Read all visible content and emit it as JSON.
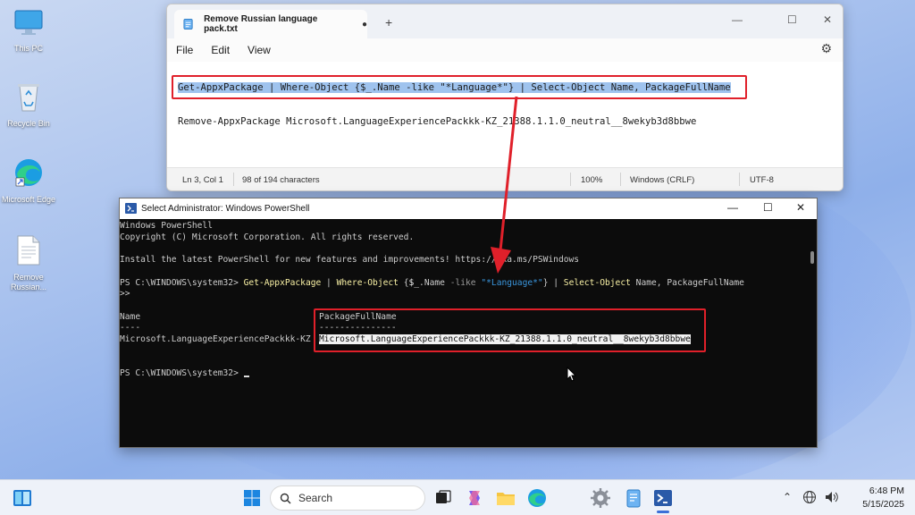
{
  "desktop": {
    "icons": [
      {
        "label": "This PC"
      },
      {
        "label": "Recycle Bin"
      },
      {
        "label": "Microsoft Edge"
      },
      {
        "label": "Remove Russian..."
      }
    ]
  },
  "notepad": {
    "tab_title": "Remove Russian language pack.txt",
    "tab_modified": "●",
    "new_tab": "+",
    "minimize": "—",
    "maximize": "☐",
    "close": "✕",
    "menu": {
      "file": "File",
      "edit": "Edit",
      "view": "View"
    },
    "line1": "Get-AppxPackage | Where-Object {$_.Name -like \"*Language*\"} | Select-Object Name, PackageFullName",
    "line2": "Remove-AppxPackage Microsoft.LanguageExperiencePackkk-KZ_21388.1.1.0_neutral__8wekyb3d8bbwe",
    "status": {
      "position": "Ln 3, Col 1",
      "chars": "98 of 194 characters",
      "zoom": "100%",
      "eol": "Windows (CRLF)",
      "encoding": "UTF-8"
    }
  },
  "powershell": {
    "title": "Select Administrator: Windows PowerShell",
    "minimize": "—",
    "maximize": "☐",
    "close": "✕",
    "header1": "Windows PowerShell",
    "header2": "Copyright (C) Microsoft Corporation. All rights reserved.",
    "install_msg": "Install the latest PowerShell for new features and improvements! https://aka.ms/PSWindows",
    "prompt": "PS C:\\WINDOWS\\system32>",
    "cmd_get": "Get-AppxPackage",
    "cmd_pipe1": " | ",
    "cmd_where": "Where-Object",
    "cmd_brace_open": " {",
    "cmd_var": "$_",
    "cmd_name": ".Name ",
    "cmd_like": "-like",
    "cmd_str": " \"*Language*\"",
    "cmd_brace_close": "}",
    "cmd_pipe2": " | ",
    "cmd_select": "Select-Object",
    "cmd_args": " Name, PackageFullName",
    "continuation": ">>",
    "col_name": "Name",
    "col_pkg": "PackageFullName",
    "dash_name": "----",
    "dash_pkg": "---------------",
    "row_name": "Microsoft.LanguageExperiencePackkk-KZ",
    "row_pkg": "Microsoft.LanguageExperiencePackkk-KZ_21388.1.1.0_neutral__8wekyb3d8bbwe",
    "prompt2": "PS C:\\WINDOWS\\system32>"
  },
  "taskbar": {
    "search_placeholder": "Search",
    "time": "6:48 PM",
    "date": "5/15/2025"
  },
  "colors": {
    "highlight_box": "#e0202a",
    "selection": "#9fc3ee",
    "ps_background": "#0c0c0c"
  }
}
